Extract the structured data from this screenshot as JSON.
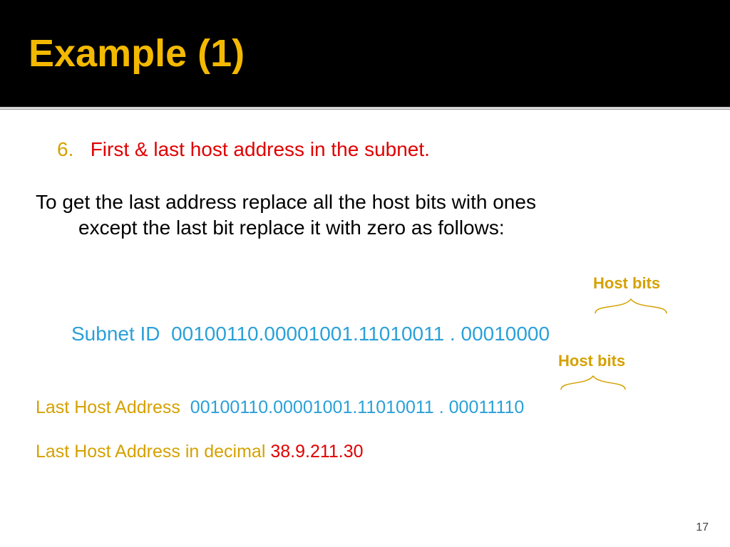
{
  "title": "Example (1)",
  "list_number": "6.",
  "list_text": "First & last host address in the subnet.",
  "para_line1": "To get the last address replace all the host bits with ones",
  "para_line2": "except the last bit replace it with zero as follows:",
  "hostbits_label": "Host bits",
  "subnet_label": "Subnet ID",
  "subnet_bits": "00100110.00001001.11010011 . 0001",
  "subnet_trail": "0000",
  "lasthost_label": "Last Host Address",
  "lasthost_bits": "00100110.00001001.11010011 . 0001",
  "lasthost_trail": "1110",
  "decimal_label": "Last Host Address in decimal",
  "decimal_value": "38.9.211.30",
  "page_number": "17"
}
